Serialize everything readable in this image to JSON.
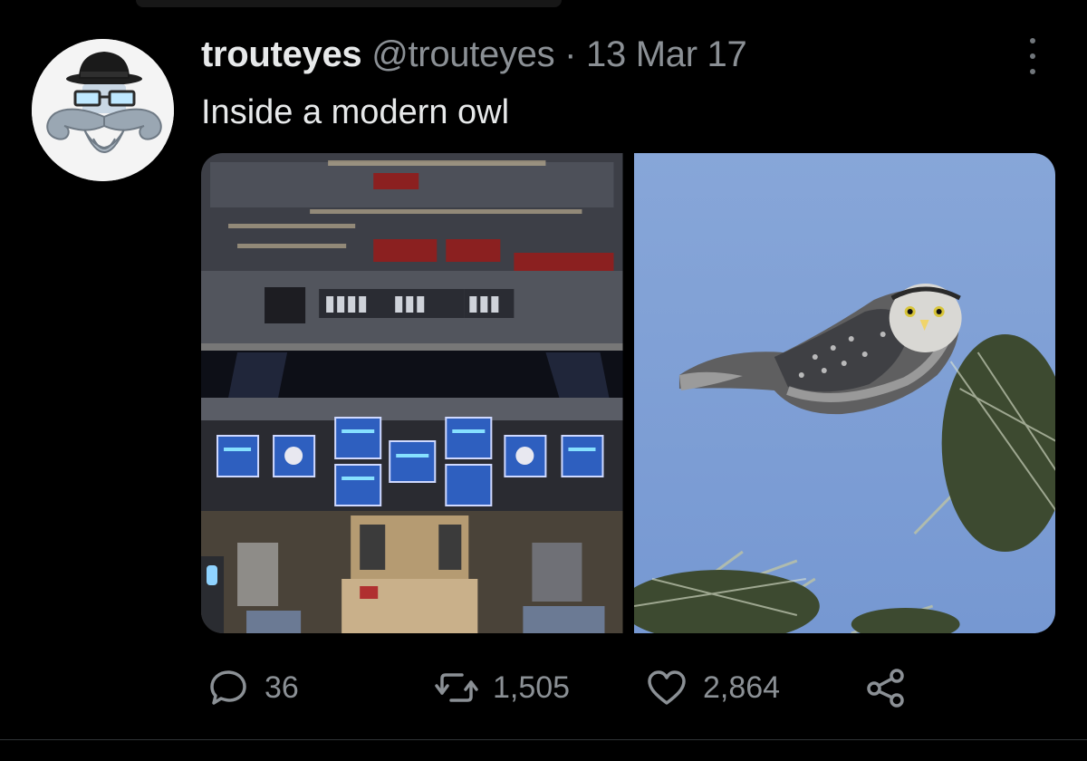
{
  "tweet": {
    "display_name": "trouteyes",
    "handle": "@trouteyes",
    "separator": "·",
    "date": "13 Mar 17",
    "text": "Inside a modern owl"
  },
  "actions": {
    "replies": "36",
    "retweets": "1,505",
    "likes": "2,864"
  },
  "icons": {
    "reply": "reply-bubble-icon",
    "retweet": "retweet-arrows-icon",
    "like": "heart-icon",
    "share": "share-nodes-icon",
    "more": "more-vertical-dots-icon"
  },
  "colors": {
    "background": "#000000",
    "text_primary": "#e7e9ea",
    "text_secondary": "#8b9095",
    "sky": "#7d9fd6"
  }
}
